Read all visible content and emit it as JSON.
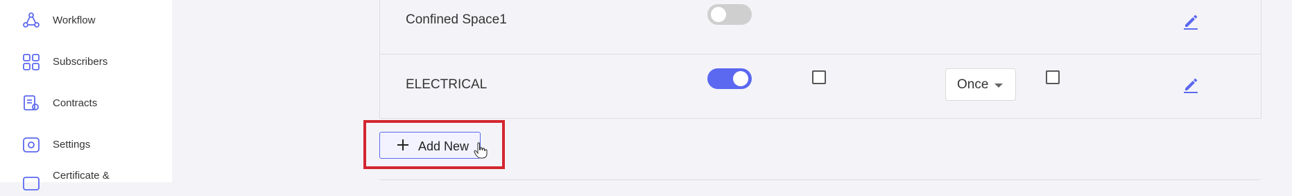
{
  "sidebar": {
    "items": [
      {
        "label": "Workflow",
        "icon": "workflow-icon"
      },
      {
        "label": "Subscribers",
        "icon": "subscribers-icon"
      },
      {
        "label": "Contracts",
        "icon": "contracts-icon"
      },
      {
        "label": "Settings",
        "icon": "settings-icon"
      },
      {
        "label": "Certificate &",
        "icon": "certificate-icon"
      }
    ]
  },
  "table": {
    "rows": [
      {
        "name": "Confined Space1",
        "enabled": false
      },
      {
        "name": "ELECTRICAL",
        "enabled": true,
        "checkbox_a": false,
        "frequency": "Once",
        "checkbox_b": false
      }
    ]
  },
  "actions": {
    "add_new_label": "Add New"
  },
  "colors": {
    "accent": "#5b68f0",
    "highlight": "#d32630",
    "toggle_off": "#cfcfcf"
  }
}
